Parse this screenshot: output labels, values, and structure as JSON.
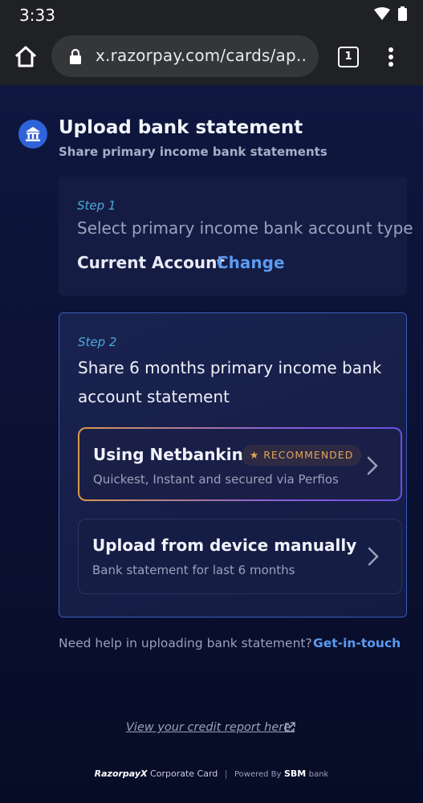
{
  "status_bar": {
    "time": "3:33"
  },
  "browser": {
    "url": "x.razorpay.com/cards/ap..",
    "tab_count": "1"
  },
  "header": {
    "title": "Upload bank statement",
    "subtitle": "Share primary income bank statements"
  },
  "step1": {
    "label": "Step 1",
    "question": "Select primary income bank account type",
    "answer": "Current Account",
    "change_label": "Change"
  },
  "step2": {
    "label": "Step 2",
    "title": "Share 6 months primary income bank account statement",
    "options": [
      {
        "title": "Using Netbanking",
        "badge": "RECOMMENDED",
        "subtitle": "Quickest, Instant and secured via Perfios"
      },
      {
        "title": "Upload from device manually",
        "subtitle": "Bank statement for last 6 months"
      }
    ]
  },
  "help": {
    "text": "Need help in uploading bank statement?",
    "link": "Get-in-touch"
  },
  "credit_report_link": "View your credit report here.",
  "footer": {
    "brand": "RazorpayX",
    "product": "Corporate Card",
    "powered_by": "Powered By",
    "partner": "SBM",
    "partner_suffix": "bank"
  },
  "colors": {
    "accent": "#5b9bf0",
    "step_label": "#4ea8dc",
    "badge_text": "#e0a65a",
    "background": "#0c1233"
  }
}
